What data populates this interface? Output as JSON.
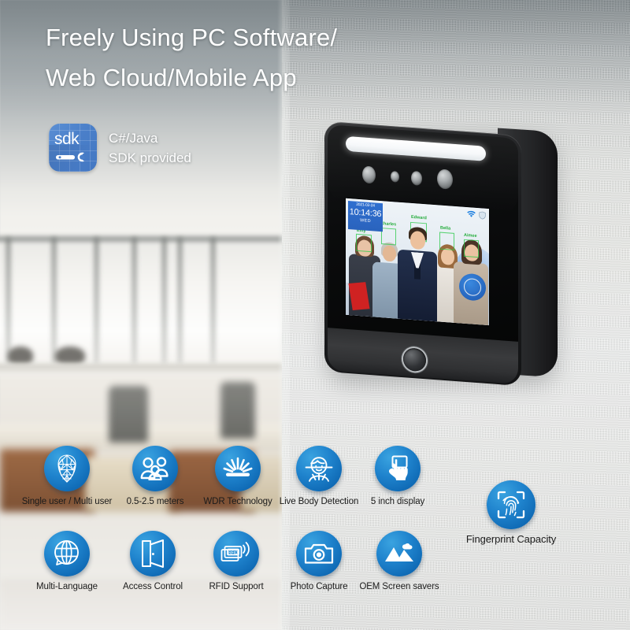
{
  "headline": "Freely Using PC Software/\nWeb Cloud/Mobile App",
  "sdk": {
    "badge_text": "sdk",
    "line1": "C#/Java",
    "line2": "SDK provided"
  },
  "device": {
    "screen": {
      "date": "2021-02-24",
      "time": "10:14:36",
      "weekday": "WED",
      "status_icons": [
        "wifi-icon",
        "shield-icon"
      ],
      "detected_names": [
        "Emy",
        "Charles",
        "Edward",
        "Bella",
        "Aimee"
      ]
    }
  },
  "features": [
    {
      "label": "Single user / Multi user",
      "icon": "face-mesh-icon"
    },
    {
      "label": "0.5-2.5 meters",
      "icon": "group-users-icon"
    },
    {
      "label": "WDR Technology",
      "icon": "light-burst-icon"
    },
    {
      "label": "Live Body Detection",
      "icon": "live-face-scan-icon"
    },
    {
      "label": "5 inch display",
      "icon": "touch-hand-icon"
    },
    {
      "label": "Multi-Language",
      "icon": "globe-speech-icon"
    },
    {
      "label": "Access Control",
      "icon": "open-door-icon"
    },
    {
      "label": "RFID Support",
      "icon": "rfid-card-icon"
    },
    {
      "label": "Photo Capture",
      "icon": "camera-icon"
    },
    {
      "label": "OEM Screen savers",
      "icon": "image-mountain-icon"
    },
    {
      "label": "Fingerprint Capacity",
      "icon": "fingerprint-scan-icon"
    }
  ],
  "colors": {
    "icon_blue": "#1f83cd",
    "icon_blue_dark": "#0b5ea3",
    "sdk_blue": "#4a7fc9",
    "clock_blue": "#2f6fd0",
    "name_green": "#1fa83a",
    "headline_white": "#ffffff"
  }
}
